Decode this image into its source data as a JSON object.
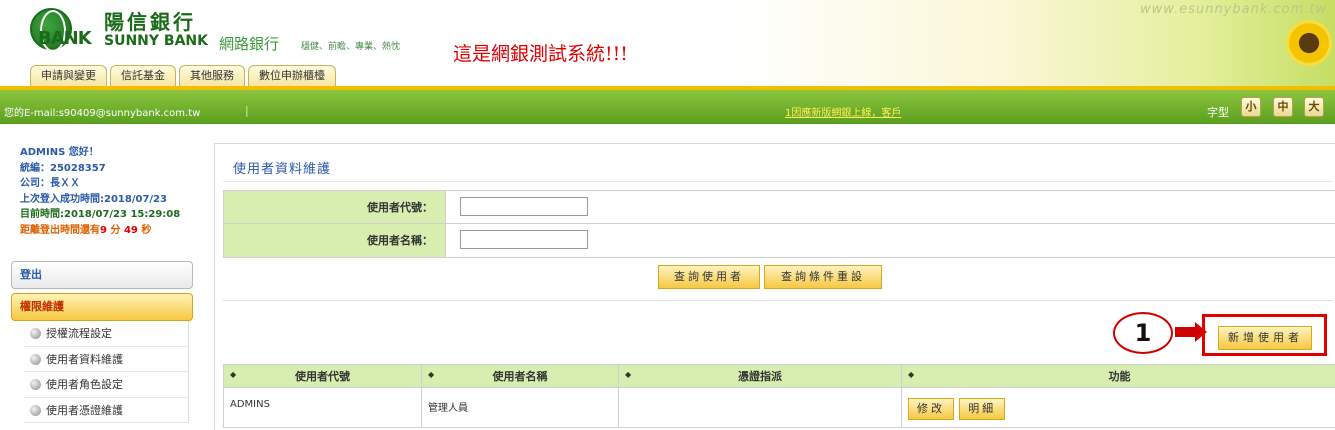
{
  "header": {
    "logo_cn": "陽信銀行",
    "logo_bank": "BANK",
    "logo_en": "SUNNY BANK",
    "netbank": "網路銀行",
    "slogan": "穩健、前瞻、專業、熱忱",
    "test_banner": "這是網銀測試系統!!!",
    "site_url": "www.esunnybank.com.tw",
    "tabs": [
      "申請與變更",
      "信託基金",
      "其他服務",
      "數位申辦櫃檯"
    ]
  },
  "greenbar": {
    "email": "您的E-mail:s90409@sunnybank.com.tw",
    "divider": "|",
    "marquee": "1因應新版網銀上線，客戶",
    "font_label": "字型",
    "font_sizes": [
      "小",
      "中",
      "大"
    ]
  },
  "sidebar": {
    "greeting": "ADMINS 您好！",
    "tax_id_label": "統編：",
    "tax_id": "25028357",
    "company_label": "公司：",
    "company": "長ＸＸ",
    "last_login_label": "上次登入成功時間:",
    "last_login": "2018/07/23",
    "current_time_label": "目前時間:",
    "current_time": "2018/07/23 15:29:08",
    "logout_countdown_label": "距離登出時間還有",
    "logout_minutes": "9",
    "minutes_unit": "分",
    "logout_seconds": "49",
    "seconds_unit": "秒",
    "logout": "登出",
    "section": "權限維護",
    "menu": [
      "授權流程設定",
      "使用者資料維護",
      "使用者角色設定",
      "使用者憑證維護"
    ]
  },
  "main": {
    "title": "使用者資料維護",
    "user_id_label": "使用者代號：",
    "user_id_value": "",
    "user_name_label": "使用者名稱：",
    "user_name_value": "",
    "query_button": "查詢使用者",
    "reset_button": "查詢條件重設",
    "callout_number": "1",
    "add_button": "新增使用者",
    "table": {
      "sort_icon": "◆",
      "headers": [
        "使用者代號",
        "使用者名稱",
        "憑證指派",
        "功能"
      ],
      "rows": [
        {
          "user_id": "ADMINS",
          "user_name": "管理人員",
          "cert": "",
          "edit": "修改",
          "detail": "明細"
        }
      ]
    }
  }
}
